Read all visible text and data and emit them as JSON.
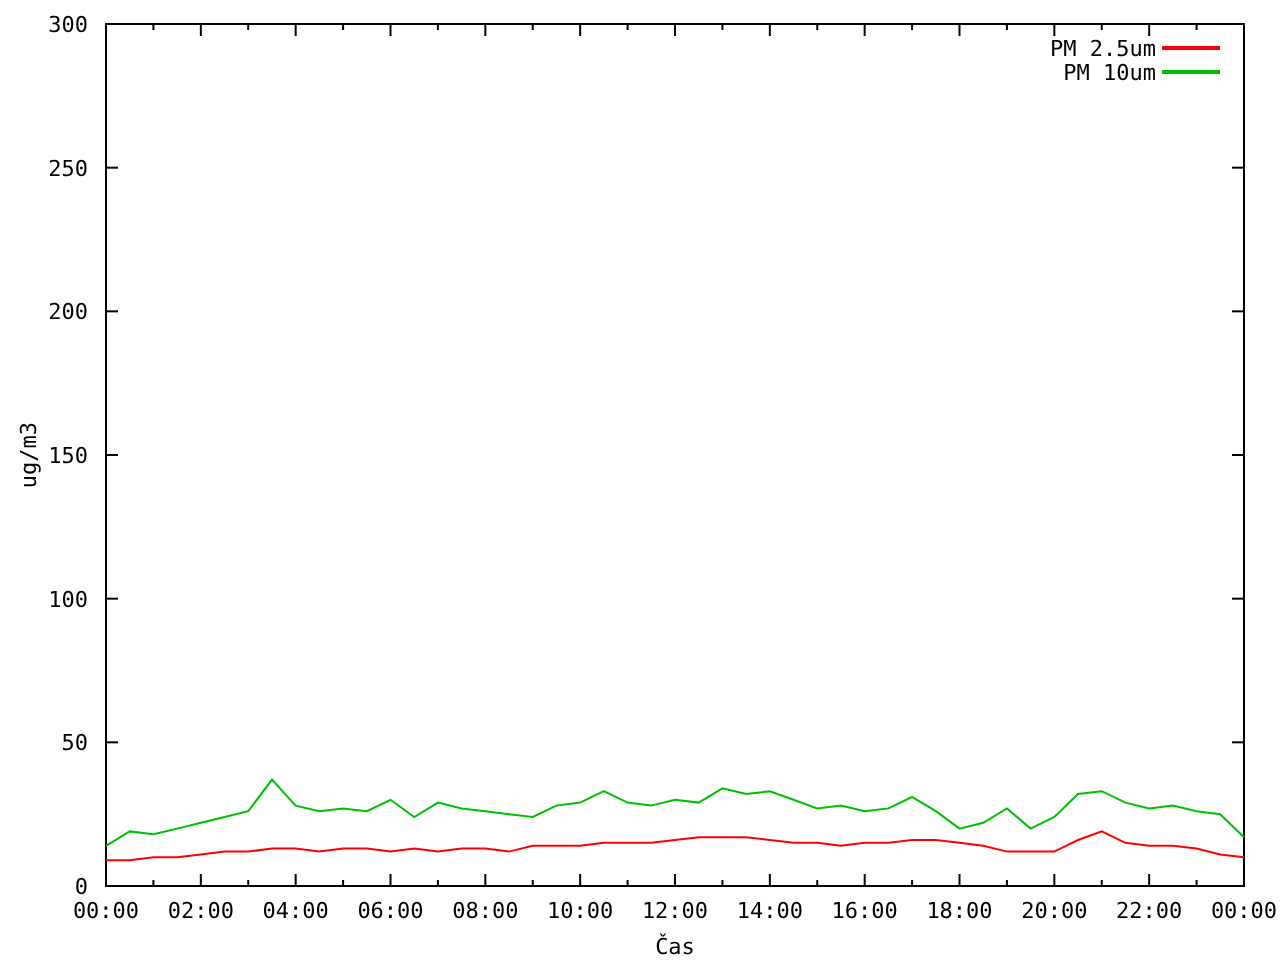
{
  "chart_data": {
    "type": "line",
    "xlabel": "Čas",
    "ylabel": "ug/m3",
    "x": [
      0,
      0.5,
      1,
      1.5,
      2,
      2.5,
      3,
      3.5,
      4,
      4.5,
      5,
      5.5,
      6,
      6.5,
      7,
      7.5,
      8,
      8.5,
      9,
      9.5,
      10,
      10.5,
      11,
      11.5,
      12,
      12.5,
      13,
      13.5,
      14,
      14.5,
      15,
      15.5,
      16,
      16.5,
      17,
      17.5,
      18,
      18.5,
      19,
      19.5,
      20,
      20.5,
      21,
      21.5,
      22,
      22.5,
      23,
      23.5,
      24
    ],
    "series": [
      {
        "name": "PM 2.5um",
        "color": "#ff0000",
        "values": [
          9,
          9,
          10,
          10,
          11,
          12,
          12,
          13,
          13,
          12,
          13,
          13,
          12,
          13,
          12,
          13,
          13,
          12,
          14,
          14,
          14,
          15,
          15,
          15,
          16,
          17,
          17,
          17,
          16,
          15,
          15,
          14,
          15,
          15,
          16,
          16,
          15,
          14,
          12,
          12,
          12,
          16,
          19,
          15,
          14,
          14,
          13,
          11,
          10
        ]
      },
      {
        "name": "PM 10um",
        "color": "#00c000",
        "values": [
          14,
          19,
          18,
          20,
          22,
          24,
          26,
          37,
          28,
          26,
          27,
          26,
          30,
          24,
          29,
          27,
          26,
          25,
          24,
          28,
          29,
          33,
          29,
          28,
          30,
          29,
          34,
          32,
          33,
          30,
          27,
          28,
          26,
          27,
          31,
          26,
          20,
          22,
          27,
          20,
          24,
          32,
          33,
          29,
          27,
          28,
          26,
          25,
          17
        ]
      }
    ],
    "legend": "upper right",
    "xlim": [
      0,
      24
    ],
    "ylim": [
      0,
      300
    ],
    "xticks": [
      {
        "value": 0,
        "label": "00:00"
      },
      {
        "value": 2,
        "label": "02:00"
      },
      {
        "value": 4,
        "label": "04:00"
      },
      {
        "value": 6,
        "label": "06:00"
      },
      {
        "value": 8,
        "label": "08:00"
      },
      {
        "value": 10,
        "label": "10:00"
      },
      {
        "value": 12,
        "label": "12:00"
      },
      {
        "value": 14,
        "label": "14:00"
      },
      {
        "value": 16,
        "label": "16:00"
      },
      {
        "value": 18,
        "label": "18:00"
      },
      {
        "value": 20,
        "label": "20:00"
      },
      {
        "value": 22,
        "label": "22:00"
      },
      {
        "value": 24,
        "label": "00:00"
      }
    ],
    "yticks": [
      0,
      50,
      100,
      150,
      200,
      250,
      300
    ]
  }
}
